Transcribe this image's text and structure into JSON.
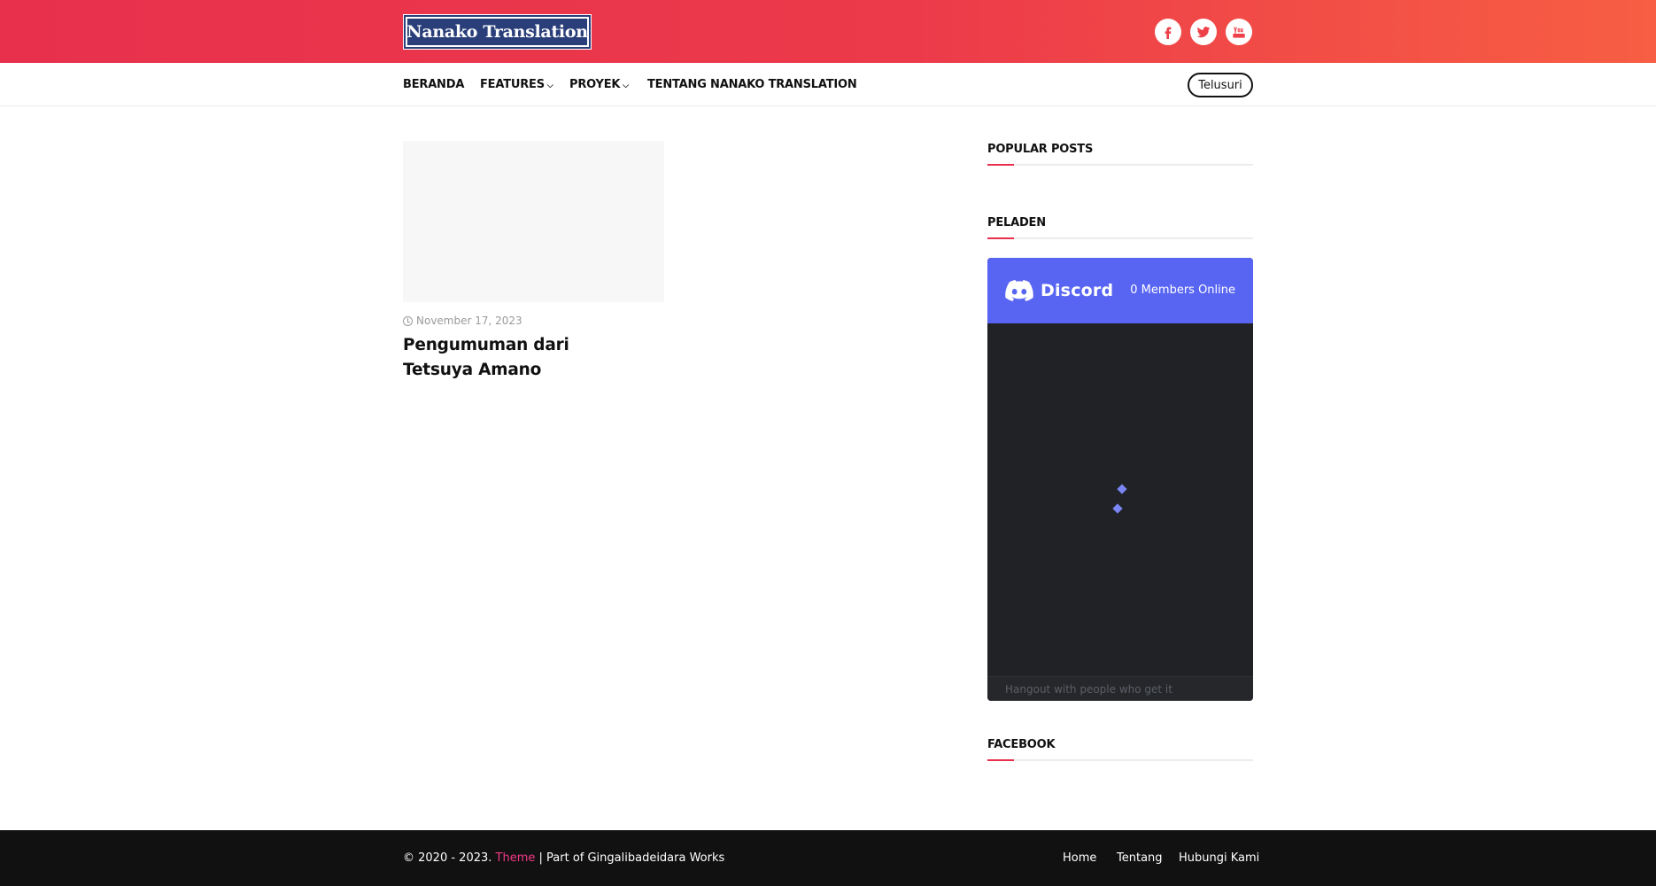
{
  "header": {
    "logo_text": "Nanako Translation",
    "social": [
      {
        "icon": "facebook-icon"
      },
      {
        "icon": "twitter-icon"
      },
      {
        "icon": "youtube-icon"
      }
    ],
    "gradient_colors": [
      "#e8304d",
      "#f75e43"
    ]
  },
  "nav": {
    "items": [
      {
        "label": "BERANDA",
        "dropdown": false
      },
      {
        "label": "FEATURES",
        "dropdown": true
      },
      {
        "label": "PROYEK",
        "dropdown": true
      },
      {
        "label": "TENTANG NANAKO TRANSLATION",
        "dropdown": false
      }
    ],
    "search_label": "Telusuri"
  },
  "main": {
    "posts": [
      {
        "date": "November 17, 2023",
        "title": "Pengumuman dari Tetsuya Amano"
      }
    ]
  },
  "sidebar": {
    "widgets": [
      {
        "title": "POPULAR POSTS"
      },
      {
        "title": "PELADEN"
      },
      {
        "title": "FACEBOOK"
      }
    ],
    "discord": {
      "brand": "Discord",
      "online": "0 Members Online",
      "footer_text": "Hangout with people who get it",
      "accent": "#5865f2",
      "body_bg": "#202225"
    }
  },
  "footer": {
    "copyright_prefix": "© 2020 - 2023.",
    "theme_label": "Theme",
    "copyright_suffix": "| Part of Gingalibadeidara Works",
    "links": [
      "Home",
      "Tentang",
      "Hubungi Kami"
    ]
  }
}
